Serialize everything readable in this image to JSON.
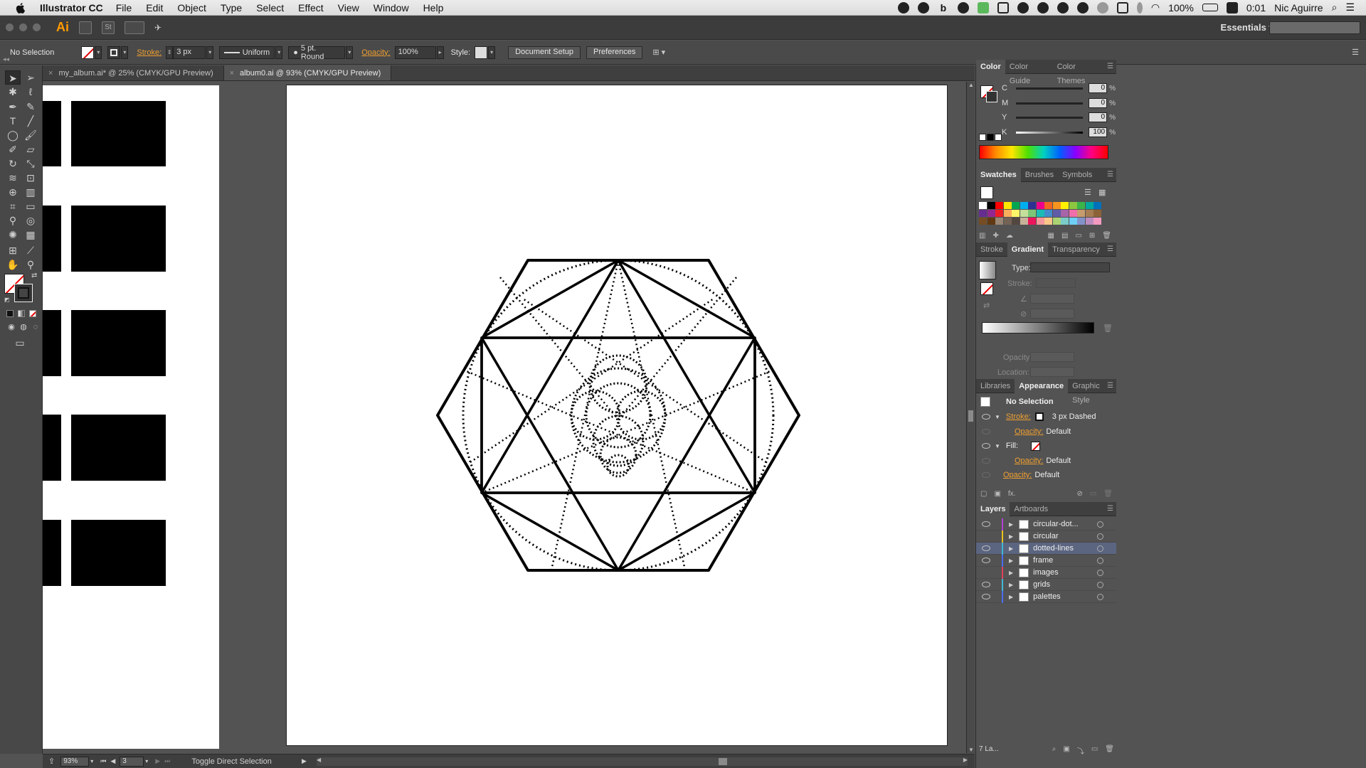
{
  "menubar": {
    "app_name": "Illustrator CC",
    "items": [
      "File",
      "Edit",
      "Object",
      "Type",
      "Select",
      "Effect",
      "View",
      "Window",
      "Help"
    ],
    "battery": "100%",
    "clock": "0:01",
    "user": "Nic Aguirre"
  },
  "appbar": {
    "logo": "Ai",
    "st_label": "St",
    "workspace": "Essentials"
  },
  "control": {
    "selection": "No Selection",
    "stroke_label": "Stroke:",
    "stroke_weight": "3 px",
    "profile": "Uniform",
    "brush": "5 pt. Round",
    "opacity_label": "Opacity:",
    "opacity_value": "100%",
    "style_label": "Style:",
    "document_setup": "Document Setup",
    "preferences": "Preferences"
  },
  "tabs": [
    {
      "label": "my_album.ai* @ 25% (CMYK/GPU Preview)"
    },
    {
      "label": "album0.ai @ 93% (CMYK/GPU Preview)"
    }
  ],
  "status": {
    "zoom": "93%",
    "artboard": "3",
    "message": "Toggle Direct Selection"
  },
  "color_panel": {
    "tabs": [
      "Color",
      "Color Guide",
      "Color Themes"
    ],
    "channels": [
      {
        "label": "C",
        "value": "0"
      },
      {
        "label": "M",
        "value": "0"
      },
      {
        "label": "Y",
        "value": "0"
      },
      {
        "label": "K",
        "value": "100"
      }
    ],
    "unit": "%"
  },
  "swatches_panel": {
    "tabs": [
      "Swatches",
      "Brushes",
      "Symbols"
    ],
    "colors": [
      "#ffffff",
      "#000000",
      "#ff0000",
      "#ffe600",
      "#00a650",
      "#00aeef",
      "#2e3192",
      "#ec008c",
      "#f26522",
      "#f7941d",
      "#fff200",
      "#8dc63f",
      "#39b54a",
      "#00a99d",
      "#0072bc",
      "#662d91",
      "#92278f",
      "#ed1c24",
      "#fbaf5d",
      "#fff568",
      "#c4df9b",
      "#7cc576",
      "#1cbbb4",
      "#448ccb",
      "#605ca8",
      "#a864a8",
      "#f06eaa",
      "#c69c6d",
      "#a67c52",
      "#8c6239",
      "#754c24",
      "#603913",
      "#998675",
      "#736357",
      "#534741",
      "#c7b299",
      "#ed145b",
      "#f5989d",
      "#fdc689",
      "#abd373",
      "#7accc8",
      "#6dcff6",
      "#8393ca",
      "#bd8cbf",
      "#f49ac1"
    ]
  },
  "gradient_panel": {
    "tabs": [
      "Stroke",
      "Gradient",
      "Transparency"
    ],
    "type_label": "Type:",
    "stroke_label": "Stroke:",
    "opacity_label": "Opacity:",
    "location_label": "Location:"
  },
  "appearance_panel": {
    "tabs": [
      "Libraries",
      "Appearance",
      "Graphic Style"
    ],
    "title": "No Selection",
    "stroke_label": "Stroke:",
    "stroke_value": "3 px Dashed",
    "opacity_label": "Opacity:",
    "opacity_value": "Default",
    "fill_label": "Fill:",
    "fill_opacity_label": "Opacity:",
    "fill_opacity_value": "Default",
    "global_opacity_label": "Opacity:",
    "global_opacity_value": "Default"
  },
  "layers_panel": {
    "tabs": [
      "Layers",
      "Artboards"
    ],
    "layers": [
      {
        "name": "circular-dot...",
        "color": "#b43fd4",
        "visible": true
      },
      {
        "name": "circular",
        "color": "#e8c21c",
        "visible": false
      },
      {
        "name": "dotted-lines",
        "color": "#3fb8d4",
        "visible": true
      },
      {
        "name": "frame",
        "color": "#4a6cf0",
        "visible": true
      },
      {
        "name": "images",
        "color": "#e0405a",
        "visible": false
      },
      {
        "name": "grids",
        "color": "#3fb8d4",
        "visible": true
      },
      {
        "name": "palettes",
        "color": "#4a6cf0",
        "visible": true
      }
    ],
    "footer": "7 La..."
  }
}
